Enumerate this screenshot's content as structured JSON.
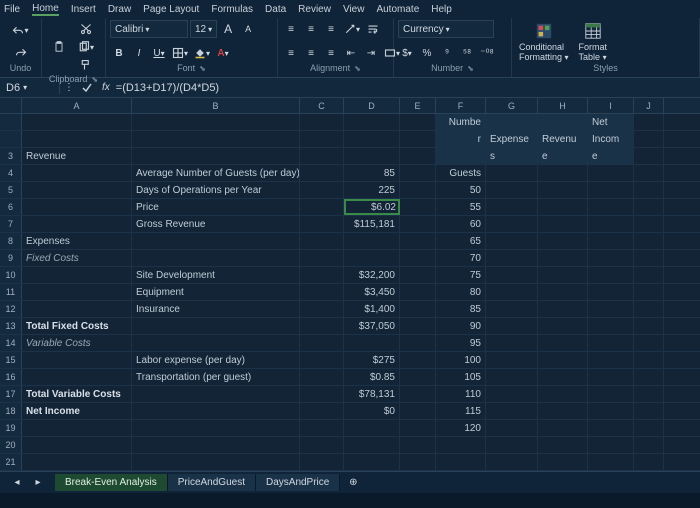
{
  "menu": {
    "items": [
      "File",
      "Home",
      "Insert",
      "Draw",
      "Page Layout",
      "Formulas",
      "Data",
      "Review",
      "View",
      "Automate",
      "Help"
    ],
    "active": "Home"
  },
  "ribbon": {
    "undo_label": "Undo",
    "clipboard_label": "Clipboard",
    "font_label": "Font",
    "alignment_label": "Alignment",
    "number_label": "Number",
    "styles_label": "Styles",
    "font_name": "Calibri",
    "font_size": "12",
    "number_format": "Currency",
    "cond_fmt_l1": "Conditional",
    "cond_fmt_l2": "Formatting",
    "fmt_tbl_l1": "Format",
    "fmt_tbl_l2": "Table",
    "currency_sym": "$",
    "pct": "%",
    "comma": "⁹",
    "dec_inc": "⁵⁸",
    "dec_dec": "⁻⁰⁸",
    "bold": "B",
    "italic": "I",
    "underline": "U",
    "grow": "A",
    "shrink": "A"
  },
  "fx": {
    "cell_ref": "D6",
    "prefix": "fx",
    "formula": "=(D13+D17)/(D4*D5)"
  },
  "columns": [
    "A",
    "B",
    "C",
    "D",
    "E",
    "F",
    "G",
    "H",
    "I",
    "J"
  ],
  "rows": [
    {
      "n": "",
      "A": "",
      "B": "",
      "C": "",
      "D": "",
      "E": "",
      "F_hdr": "Numbe",
      "G_hdr": "",
      "H_hdr": "",
      "I_hdr": "Net"
    },
    {
      "n": "",
      "A": "",
      "B": "",
      "C": "",
      "D": "",
      "E": "",
      "F_hdr": "r",
      "G_hdr": "Expense",
      "H_hdr": "Revenu",
      "I_hdr": "Incom"
    },
    {
      "n": "3",
      "A": "Revenue",
      "B": "",
      "D": "",
      "F_hdr": "",
      "G_hdr": "s",
      "H_hdr": "e",
      "I_hdr": "e"
    },
    {
      "n": "4",
      "A": "",
      "B": "Average Number of Guests (per day)",
      "D": "85",
      "F": "Guests"
    },
    {
      "n": "5",
      "A": "",
      "B": "Days of Operations per Year",
      "D": "225",
      "F": "50"
    },
    {
      "n": "6",
      "A": "",
      "B": "Price",
      "D": "$6.02",
      "F": "55",
      "sel": true
    },
    {
      "n": "7",
      "A": "",
      "B": "Gross Revenue",
      "D": "$115,181",
      "F": "60"
    },
    {
      "n": "8",
      "A": "Expenses",
      "B": "",
      "D": "",
      "F": "65"
    },
    {
      "n": "9",
      "A": "Fixed Costs",
      "B": "",
      "D": "",
      "F": "70",
      "Aitalic": true
    },
    {
      "n": "10",
      "A": "",
      "B": "Site Development",
      "D": "$32,200",
      "F": "75"
    },
    {
      "n": "11",
      "A": "",
      "B": "Equipment",
      "D": "$3,450",
      "F": "80"
    },
    {
      "n": "12",
      "A": "",
      "B": "Insurance",
      "D": "$1,400",
      "F": "85"
    },
    {
      "n": "13",
      "A": "Total Fixed Costs",
      "B": "",
      "D": "$37,050",
      "F": "90",
      "Abold": true
    },
    {
      "n": "14",
      "A": "Variable Costs",
      "B": "",
      "D": "",
      "F": "95",
      "Aitalic": true
    },
    {
      "n": "15",
      "A": "",
      "B": "Labor expense (per day)",
      "D": "$275",
      "F": "100"
    },
    {
      "n": "16",
      "A": "",
      "B": "Transportation (per guest)",
      "D": "$0.85",
      "F": "105"
    },
    {
      "n": "17",
      "A": "Total Variable Costs",
      "B": "",
      "D": "$78,131",
      "F": "110",
      "Abold": true
    },
    {
      "n": "18",
      "A": "Net Income",
      "B": "",
      "D": "$0",
      "F": "115",
      "Abold": true
    },
    {
      "n": "19",
      "A": "",
      "B": "",
      "D": "",
      "F": "120"
    },
    {
      "n": "20",
      "A": "",
      "B": "",
      "D": "",
      "F": ""
    },
    {
      "n": "21",
      "A": "",
      "B": "",
      "D": "",
      "F": ""
    }
  ],
  "sheets": {
    "tabs": [
      "Break-Even Analysis",
      "PriceAndGuest",
      "DaysAndPrice"
    ],
    "active": 0
  }
}
